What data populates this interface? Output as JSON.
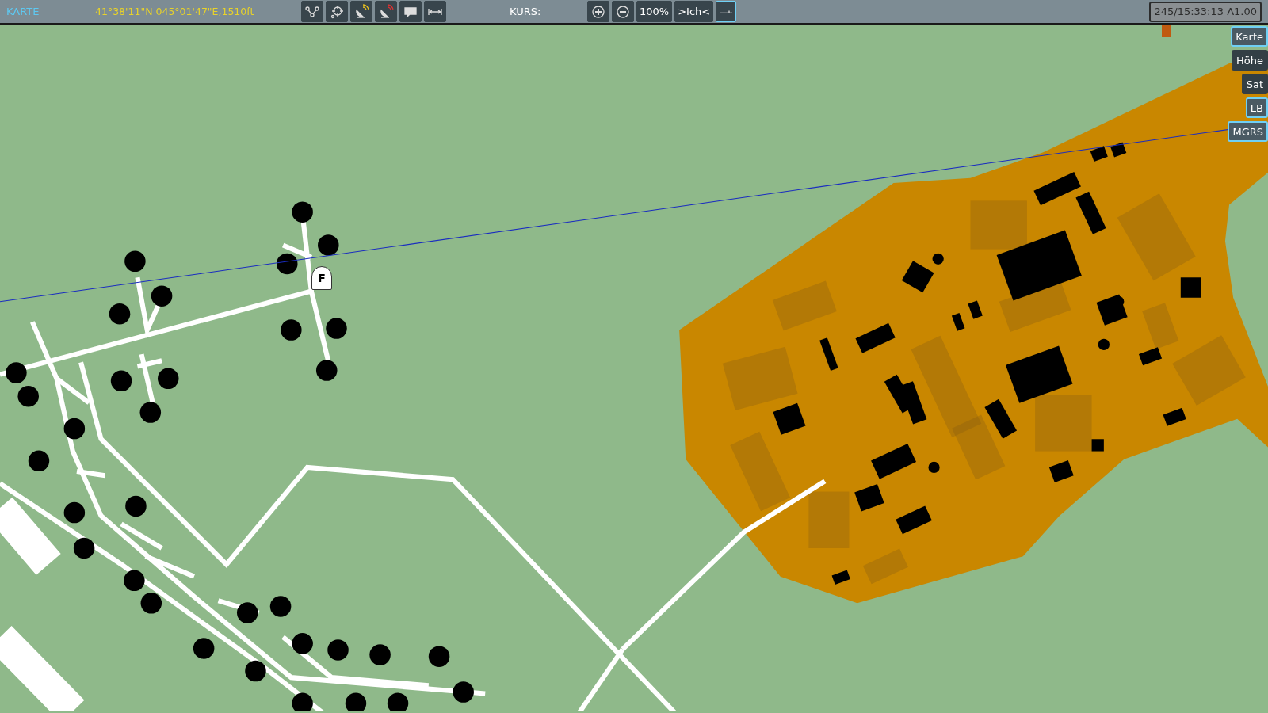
{
  "top_bar": {
    "mode": "KARTE",
    "position": "41°38'11\"N 045°01'47\"E,1510ft",
    "course_label": "KURS:",
    "zoom_level": "100%",
    "center_label": ">Ich<",
    "line_toggle": {
      "selected": true
    },
    "clock": "245/15:33:13 A1.00"
  },
  "layer_buttons": [
    {
      "label": "Karte",
      "selected": true
    },
    {
      "label": "Höhe",
      "selected": false
    },
    {
      "label": "Sat",
      "selected": false
    },
    {
      "label": "LB",
      "selected": true
    },
    {
      "label": "MGRS",
      "selected": true
    }
  ],
  "map": {
    "marker": "F"
  }
}
